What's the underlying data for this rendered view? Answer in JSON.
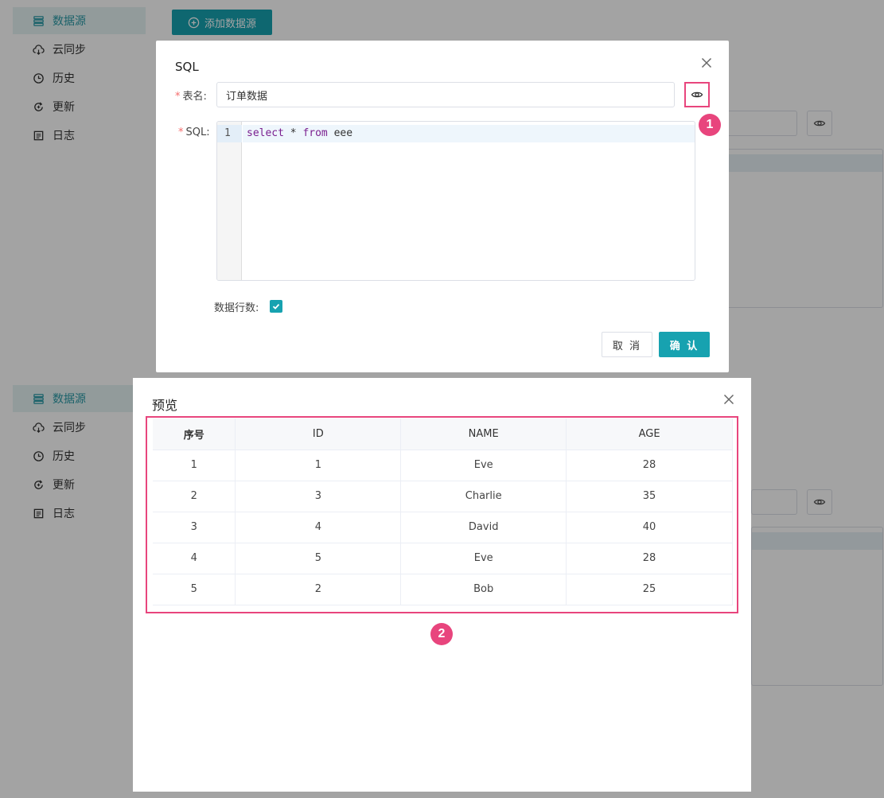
{
  "sidebar": {
    "items": [
      {
        "label": "数据源",
        "icon": "database-icon",
        "active": true
      },
      {
        "label": "云同步",
        "icon": "cloud-sync-icon",
        "active": false
      },
      {
        "label": "历史",
        "icon": "clock-icon",
        "active": false
      },
      {
        "label": "更新",
        "icon": "refresh-icon",
        "active": false
      },
      {
        "label": "日志",
        "icon": "log-icon",
        "active": false
      }
    ]
  },
  "toolbar": {
    "add_label": "添加数据源"
  },
  "sql_dialog": {
    "title": "SQL",
    "table_name_label": "表名:",
    "table_name_value": "订单数据",
    "sql_label": "SQL:",
    "line_number": "1",
    "code": {
      "kw1": "select",
      "mid": " * ",
      "kw2": "from",
      "rest": " eee"
    },
    "rows_label": "数据行数:",
    "rows_checked": true,
    "cancel_label": "取 消",
    "confirm_label": "确 认"
  },
  "preview_dialog": {
    "title": "预览",
    "columns": [
      "序号",
      "ID",
      "NAME",
      "AGE"
    ],
    "rows": [
      [
        "1",
        "1",
        "Eve",
        "28"
      ],
      [
        "2",
        "3",
        "Charlie",
        "35"
      ],
      [
        "3",
        "4",
        "David",
        "40"
      ],
      [
        "4",
        "5",
        "Eve",
        "28"
      ],
      [
        "5",
        "2",
        "Bob",
        "25"
      ]
    ]
  },
  "annotations": {
    "badge1": "1",
    "badge2": "2"
  },
  "colors": {
    "accent": "#17a2b0",
    "highlight": "#e8457d",
    "required": "#f56c6c"
  }
}
